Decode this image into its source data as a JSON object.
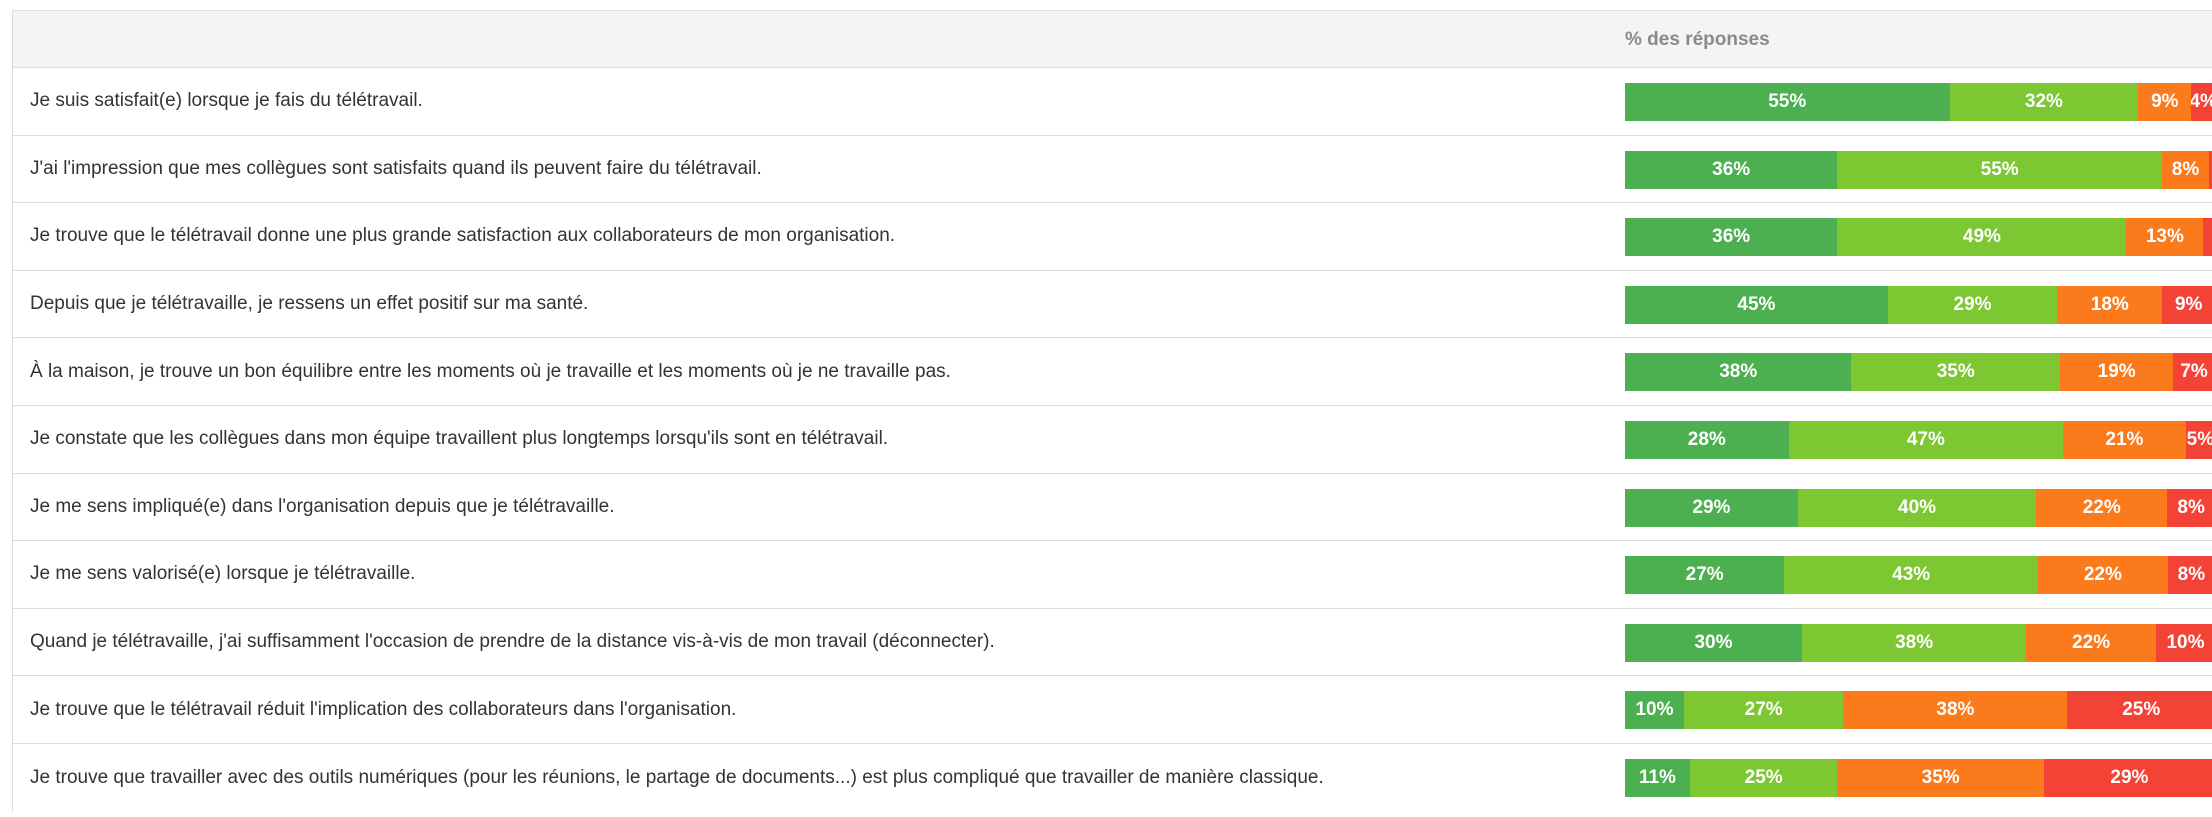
{
  "header": {
    "column_title": "% des réponses"
  },
  "colors": {
    "tout_a_fait_d_accord": "#4caf50",
    "plutot_d_accord": "#7dc832",
    "plutot_pas_d_accord": "#fb7a1c",
    "pas_du_tout_d_accord": "#f34336"
  },
  "chart_data": {
    "type": "bar",
    "orientation": "horizontal",
    "stacked": "percent",
    "title": "",
    "xlabel": "% des réponses",
    "ylabel": "",
    "xlim": [
      0,
      100
    ],
    "grid": false,
    "legend": "none",
    "categories": [
      "Je suis satisfait(e) lorsque je fais du télétravail.",
      "J'ai l'impression que mes collègues sont satisfaits quand ils peuvent faire du télétravail.",
      "Je trouve que le télétravail donne une plus grande satisfaction aux collaborateurs de mon organisation.",
      "Depuis que je télétravaille, je ressens un effet positif sur ma santé.",
      "À la maison, je trouve un bon équilibre entre les moments où je travaille et les moments où je ne travaille pas.",
      "Je constate que les collègues dans mon équipe travaillent plus longtemps lorsqu'ils sont en télétravail.",
      "Je me sens impliqué(e) dans l'organisation depuis que je télétravaille.",
      "Je me sens valorisé(e) lorsque je télétravaille.",
      "Quand je télétravaille, j'ai suffisamment l'occasion de prendre de la distance vis-à-vis de mon travail (déconnecter).",
      "Je trouve que le télétravail réduit l'implication des collaborateurs dans l'organisation.",
      "Je trouve que travailler avec des outils numériques (pour les réunions, le partage de documents...) est plus compliqué que travailler de manière classique."
    ],
    "series": [
      {
        "color": "#4caf50",
        "values": [
          55,
          36,
          36,
          45,
          38,
          28,
          29,
          27,
          30,
          10,
          11
        ]
      },
      {
        "color": "#7dc832",
        "values": [
          32,
          55,
          49,
          29,
          35,
          47,
          40,
          43,
          38,
          27,
          25
        ]
      },
      {
        "color": "#fb7a1c",
        "values": [
          9,
          8,
          13,
          18,
          19,
          21,
          22,
          22,
          22,
          38,
          35
        ]
      },
      {
        "color": "#f34336",
        "values": [
          4,
          1,
          2,
          9,
          7,
          5,
          8,
          8,
          10,
          25,
          29
        ]
      }
    ],
    "data_labels": [
      [
        "55%",
        "32%",
        "9%",
        "4%"
      ],
      [
        "36%",
        "55%",
        "8%",
        ""
      ],
      [
        "36%",
        "49%",
        "13%",
        ""
      ],
      [
        "45%",
        "29%",
        "18%",
        "9%"
      ],
      [
        "38%",
        "35%",
        "19%",
        "7%"
      ],
      [
        "28%",
        "47%",
        "21%",
        "5%"
      ],
      [
        "29%",
        "40%",
        "22%",
        "8%"
      ],
      [
        "27%",
        "43%",
        "22%",
        "8%"
      ],
      [
        "30%",
        "38%",
        "22%",
        "10%"
      ],
      [
        "10%",
        "27%",
        "38%",
        "25%"
      ],
      [
        "11%",
        "25%",
        "35%",
        "29%"
      ]
    ]
  }
}
